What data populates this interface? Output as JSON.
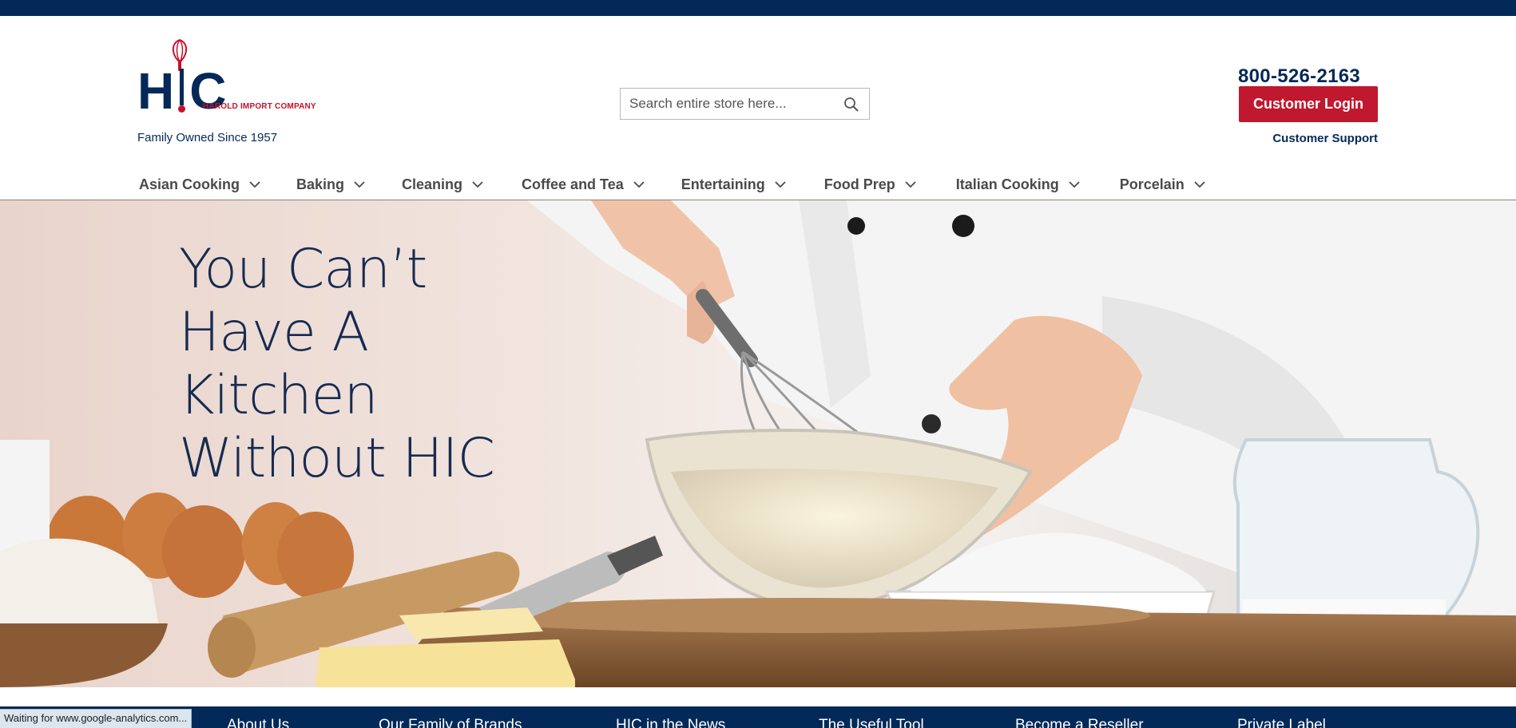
{
  "brand": {
    "logo_letters": [
      "H",
      "C"
    ],
    "company_name": "HAROLD IMPORT COMPANY",
    "tagline": "Family Owned Since 1957",
    "accent_red": "#c0182f",
    "navy": "#032958"
  },
  "header": {
    "search_placeholder": "Search entire store here...",
    "phone": "800-526-2163",
    "login_label": "Customer Login",
    "support_label": "Customer Support"
  },
  "nav": {
    "items": [
      {
        "label": "Asian Cooking"
      },
      {
        "label": "Baking"
      },
      {
        "label": "Cleaning"
      },
      {
        "label": "Coffee and Tea"
      },
      {
        "label": "Entertaining"
      },
      {
        "label": "Food Prep"
      },
      {
        "label": "Italian Cooking"
      },
      {
        "label": "Porcelain"
      }
    ]
  },
  "hero": {
    "heading_lines": [
      "You Can’t",
      "Have A",
      "Kitchen",
      "Without HIC"
    ]
  },
  "footer": {
    "links": [
      {
        "label": "About Us"
      },
      {
        "label": "Our Family of Brands"
      },
      {
        "label": "HIC in the News"
      },
      {
        "label": "The Useful Tool"
      },
      {
        "label": "Become a Reseller"
      },
      {
        "label": "Private Label"
      }
    ]
  },
  "browser": {
    "status_text": "Waiting for www.google-analytics.com..."
  }
}
